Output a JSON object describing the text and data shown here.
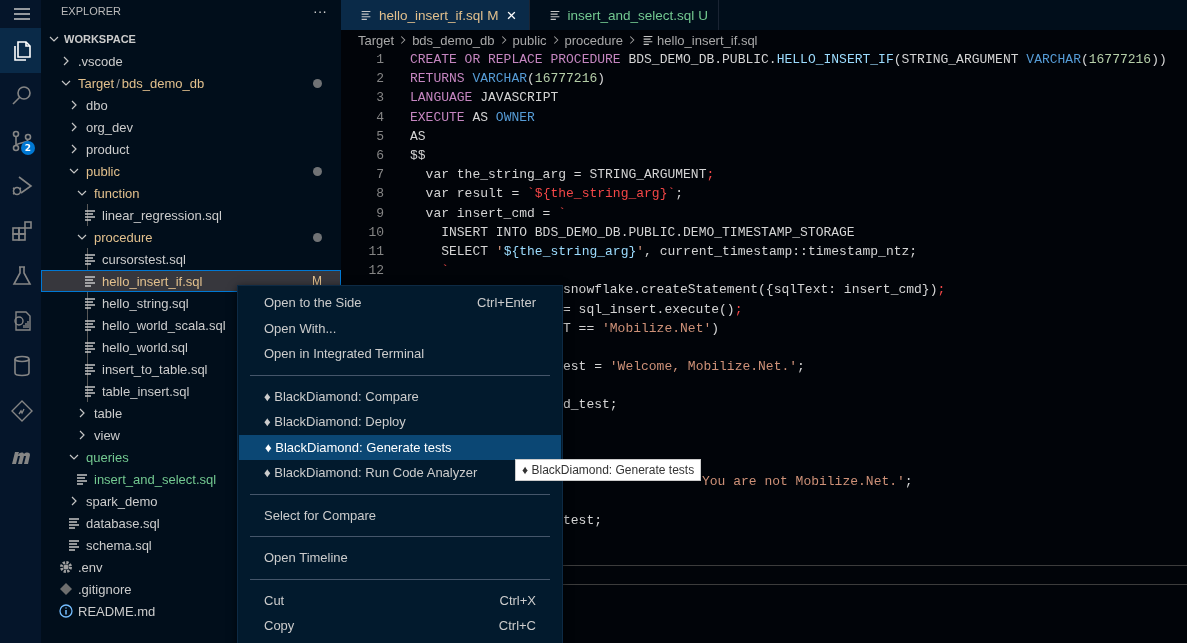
{
  "activity_bar": {
    "items": [
      {
        "kind": "menu",
        "selected": false
      },
      {
        "kind": "explorer",
        "selected": true
      },
      {
        "kind": "search",
        "selected": false
      },
      {
        "kind": "source-control",
        "selected": false,
        "badge": "2"
      },
      {
        "kind": "run",
        "selected": false
      },
      {
        "kind": "extensions",
        "selected": false
      },
      {
        "kind": "flask",
        "selected": false
      },
      {
        "kind": "report",
        "selected": false
      },
      {
        "kind": "database",
        "selected": false
      },
      {
        "kind": "diamond",
        "selected": false
      },
      {
        "kind": "logo",
        "selected": false
      }
    ]
  },
  "sidebar": {
    "title": "EXPLORER",
    "more": "···",
    "section": "WORKSPACE",
    "tree": [
      {
        "label": ".vscode",
        "kind": "folder",
        "expanded": false
      },
      {
        "label": "Target",
        "separator": "/",
        "label_2": "bds_demo_db",
        "kind": "folder",
        "expanded": true,
        "modified": true,
        "dot": true,
        "children": [
          {
            "label": "dbo",
            "kind": "folder",
            "expanded": false
          },
          {
            "label": "org_dev",
            "kind": "folder",
            "expanded": false
          },
          {
            "label": "product",
            "kind": "folder",
            "expanded": false
          },
          {
            "label": "public",
            "kind": "folder",
            "expanded": true,
            "modified": true,
            "dot": true,
            "children": [
              {
                "label": "function",
                "kind": "folder",
                "expanded": true,
                "modified": true,
                "children": [
                  {
                    "label": "linear_regression.sql",
                    "kind": "file"
                  }
                ]
              },
              {
                "label": "procedure",
                "kind": "folder",
                "expanded": true,
                "modified": true,
                "dot": true,
                "children": [
                  {
                    "label": "cursorstest.sql",
                    "kind": "file"
                  },
                  {
                    "label": "hello_insert_if.sql",
                    "kind": "file",
                    "modified": true,
                    "badge": "M",
                    "selected": true
                  },
                  {
                    "label": "hello_string.sql",
                    "kind": "file"
                  },
                  {
                    "label": "hello_world_scala.sql",
                    "kind": "file"
                  },
                  {
                    "label": "hello_world.sql",
                    "kind": "file"
                  },
                  {
                    "label": "insert_to_table.sql",
                    "kind": "file"
                  },
                  {
                    "label": "table_insert.sql",
                    "kind": "file"
                  }
                ]
              },
              {
                "label": "table",
                "kind": "folder",
                "expanded": false
              },
              {
                "label": "view",
                "kind": "folder",
                "expanded": false
              }
            ]
          },
          {
            "label": "queries",
            "kind": "folder",
            "expanded": true,
            "untracked": true,
            "children": [
              {
                "label": "insert_and_select.sql",
                "kind": "file",
                "untracked": true
              }
            ]
          },
          {
            "label": "spark_demo",
            "kind": "folder",
            "expanded": false
          },
          {
            "label": "database.sql",
            "kind": "file"
          },
          {
            "label": "schema.sql",
            "kind": "file"
          }
        ]
      },
      {
        "label": ".env",
        "kind": "gear"
      },
      {
        "label": ".gitignore",
        "kind": "git"
      },
      {
        "label": "README.md",
        "kind": "info"
      }
    ]
  },
  "tabs": [
    {
      "label": "hello_insert_if.sql",
      "badge": "M",
      "modified": true,
      "selected": true,
      "close": "×"
    },
    {
      "label": "insert_and_select.sql",
      "badge": "U",
      "untracked": true,
      "selected": false
    }
  ],
  "breadcrumb": [
    "Target",
    "bds_demo_db",
    "public",
    "procedure",
    "hello_insert_if.sql"
  ],
  "code": [
    {
      "kind": "full",
      "number": "1",
      "tokens": [
        {
          "kind": "keyword",
          "text": "CREATE OR REPLACE PROCEDURE"
        },
        {
          "kind": "plain",
          "text": " BDS_DEMO_DB.PUBLIC."
        },
        {
          "kind": "name",
          "text": "HELLO_INSERT_IF"
        },
        {
          "kind": "plain",
          "text": "(STRING_ARGUMENT "
        },
        {
          "kind": "type",
          "text": "VARCHAR"
        },
        {
          "kind": "plain",
          "text": "("
        },
        {
          "kind": "number",
          "text": "16777216"
        },
        {
          "kind": "plain",
          "text": "))"
        }
      ]
    },
    {
      "kind": "full",
      "number": "2",
      "tokens": [
        {
          "kind": "keyword",
          "text": "RETURNS"
        },
        {
          "kind": "type",
          "text": " VARCHAR"
        },
        {
          "kind": "plain",
          "text": "("
        },
        {
          "kind": "number",
          "text": "16777216"
        },
        {
          "kind": "plain",
          "text": ")"
        }
      ]
    },
    {
      "kind": "full",
      "number": "3",
      "tokens": [
        {
          "kind": "keyword",
          "text": "LANGUAGE"
        },
        {
          "kind": "plain",
          "text": " JAVASCRIPT"
        }
      ]
    },
    {
      "kind": "full",
      "number": "4",
      "tokens": [
        {
          "kind": "keyword",
          "text": "EXECUTE"
        },
        {
          "kind": "plain",
          "text": " AS "
        },
        {
          "kind": "type",
          "text": "OWNER"
        }
      ]
    },
    {
      "kind": "full",
      "number": "5",
      "tokens": [
        {
          "kind": "plain",
          "text": "AS"
        }
      ]
    },
    {
      "kind": "full",
      "number": "6",
      "tokens": [
        {
          "kind": "plain",
          "text": "$$"
        }
      ]
    },
    {
      "kind": "full",
      "number": "7",
      "tokens": [
        {
          "kind": "plain",
          "text": "  var the_string_arg = STRING_ARGUMENT"
        },
        {
          "kind": "template",
          "text": ";"
        }
      ]
    },
    {
      "kind": "full",
      "number": "8",
      "tokens": [
        {
          "kind": "plain",
          "text": "  var result = "
        },
        {
          "kind": "template",
          "text": "`${the_string_arg}`"
        },
        {
          "kind": "plain",
          "text": ";"
        }
      ]
    },
    {
      "kind": "full",
      "number": "9",
      "tokens": [
        {
          "kind": "plain",
          "text": "  var insert_cmd = "
        },
        {
          "kind": "template",
          "text": "`"
        }
      ]
    },
    {
      "kind": "full",
      "number": "10",
      "tokens": [
        {
          "kind": "plain",
          "text": "    INSERT INTO BDS_DEMO_DB.PUBLIC.DEMO_TIMESTAMP_STORAGE"
        }
      ]
    },
    {
      "kind": "full",
      "number": "11",
      "tokens": [
        {
          "kind": "plain",
          "text": "    SELECT "
        },
        {
          "kind": "string",
          "text": "'"
        },
        {
          "kind": "name",
          "text": "${the_string_arg}"
        },
        {
          "kind": "string",
          "text": "'"
        },
        {
          "kind": "plain",
          "text": ", current_timestamp::timestamp_ntz;"
        }
      ]
    },
    {
      "kind": "full",
      "number": "12",
      "tokens": [
        {
          "kind": "template",
          "text": "    `"
        }
      ]
    },
    {
      "kind": "under-menu",
      "tokens": [
        {
          "kind": "plain",
          "text": "snowflake.createStatement({sqlText: insert_cmd})"
        },
        {
          "kind": "template",
          "text": ";"
        }
      ]
    },
    {
      "kind": "under-menu",
      "tokens": [
        {
          "kind": "plain",
          "text": "= sql_insert.execute()"
        },
        {
          "kind": "template",
          "text": ";"
        }
      ]
    },
    {
      "kind": "under-menu",
      "tokens": [
        {
          "kind": "plain",
          "text": "T == "
        },
        {
          "kind": "string",
          "text": "'Mobilize.Net'"
        },
        {
          "kind": "plain",
          "text": ")"
        }
      ]
    },
    {
      "kind": "hidden"
    },
    {
      "kind": "under-menu",
      "tokens": [
        {
          "kind": "plain",
          "text": "est = "
        },
        {
          "kind": "string",
          "text": "'Welcome, Mobilize.Net.'"
        },
        {
          "kind": "plain",
          "text": ";"
        }
      ]
    },
    {
      "kind": "hidden"
    },
    {
      "kind": "under-menu",
      "tokens": [
        {
          "kind": "plain",
          "text": "d_test;"
        }
      ]
    },
    {
      "kind": "hidden"
    },
    {
      "kind": "hidden"
    },
    {
      "kind": "hidden"
    },
    {
      "kind": "under-tip",
      "tokens": [
        {
          "kind": "string",
          "text": "You are not Mobilize.Net.'"
        },
        {
          "kind": "plain",
          "text": ";"
        }
      ]
    },
    {
      "kind": "hidden"
    },
    {
      "kind": "under-menu",
      "tokens": [
        {
          "kind": "plain",
          "text": "test;"
        }
      ]
    }
  ],
  "context_menu": {
    "groups": [
      [
        {
          "label": "Open to the Side",
          "shortcut": "Ctrl+Enter",
          "selected": false
        },
        {
          "label": "Open With...",
          "selected": false
        },
        {
          "label": "Open in Integrated Terminal",
          "selected": false
        }
      ],
      [
        {
          "label": "♦ BlackDiamond: Compare",
          "selected": false
        },
        {
          "label": "♦ BlackDiamond: Deploy",
          "selected": false
        },
        {
          "label": "♦ BlackDiamond: Generate tests",
          "selected": true
        },
        {
          "label": "♦ BlackDiamond: Run Code Analyzer",
          "selected": false
        }
      ],
      [
        {
          "label": "Select for Compare",
          "selected": false
        }
      ],
      [
        {
          "label": "Open Timeline",
          "selected": false
        }
      ],
      [
        {
          "label": "Cut",
          "shortcut": "Ctrl+X",
          "selected": false
        },
        {
          "label": "Copy",
          "shortcut": "Ctrl+C",
          "selected": false
        }
      ]
    ]
  },
  "tooltip": "♦ BlackDiamond: Generate tests"
}
